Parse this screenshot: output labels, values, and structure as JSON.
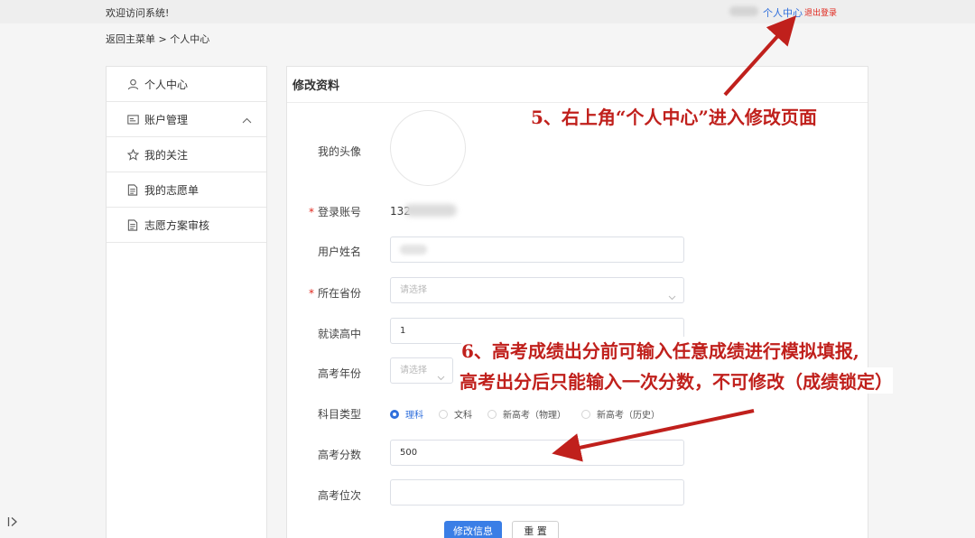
{
  "header": {
    "welcome": "欢迎访问系统!",
    "personal_center": "个人中心",
    "logout": "退出登录"
  },
  "breadcrumb": "返回主菜单 > 个人中心",
  "sidebar": {
    "items": [
      {
        "label": "个人中心",
        "icon": "user-icon"
      },
      {
        "label": "账户管理",
        "icon": "id-card-icon"
      },
      {
        "label": "我的关注",
        "icon": "star-icon"
      },
      {
        "label": "我的志愿单",
        "icon": "document-icon"
      },
      {
        "label": "志愿方案审核",
        "icon": "document-icon"
      }
    ]
  },
  "form": {
    "title": "修改资料",
    "avatar_label": "我的头像",
    "account_label": "登录账号",
    "account_value": "132",
    "name_label": "用户姓名",
    "province_label": "所在省份",
    "province_placeholder": "请选择",
    "school_label": "就读高中",
    "school_value": "1",
    "year_label": "高考年份",
    "year_placeholder": "请选择",
    "subject_label": "科目类型",
    "subject_options": [
      "理科",
      "文科",
      "新高考（物理）",
      "新高考（历史）"
    ],
    "selected_subject": "理科",
    "score_label": "高考分数",
    "score_value": "500",
    "rank_label": "高考位次",
    "rank_value": "",
    "submit_label": "修改信息",
    "reset_label": "重 置"
  },
  "annotations": {
    "step5": "5、右上角“个人中心”进入修改页面",
    "step6_line1": "6、高考成绩出分前可输入任意成绩进行模拟填报,",
    "step6_line2": "高考出分后只能输入一次分数，不可修改（成绩锁定）"
  },
  "colors": {
    "accent": "#2f6fdc",
    "annotation": "#c0201c",
    "logout": "#e0261c"
  },
  "corner_icon": "sidebar-toggle-icon"
}
